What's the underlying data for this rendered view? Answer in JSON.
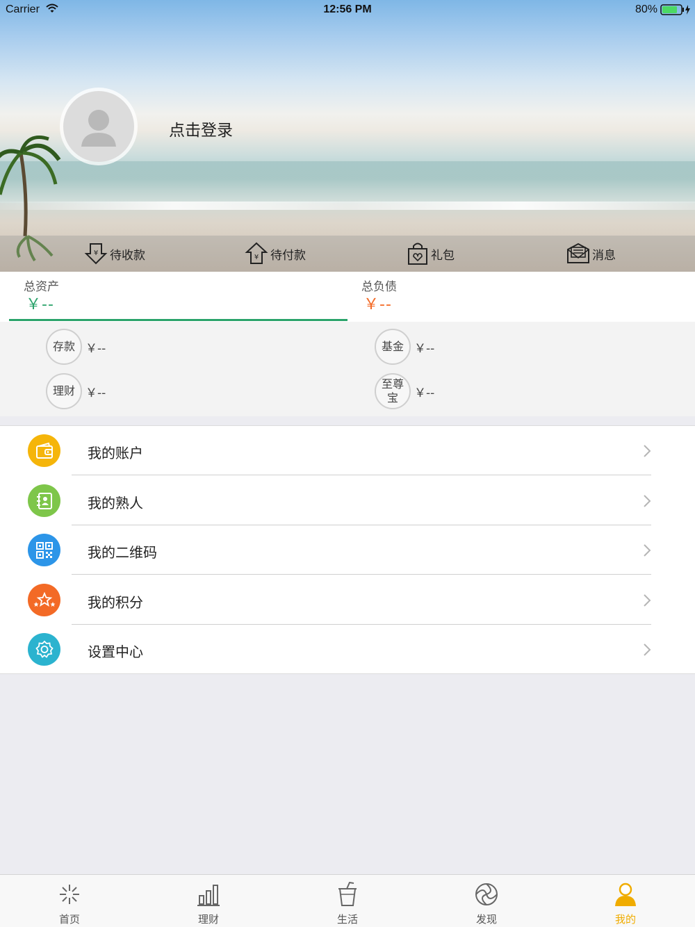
{
  "status_bar": {
    "carrier": "Carrier",
    "time": "12:56 PM",
    "battery": "80%"
  },
  "profile": {
    "login_label": "点击登录"
  },
  "quick_actions": [
    {
      "label": "待收款",
      "icon": "receive-money-icon"
    },
    {
      "label": "待付款",
      "icon": "pay-money-icon"
    },
    {
      "label": "礼包",
      "icon": "gift-bag-icon"
    },
    {
      "label": "消息",
      "icon": "message-icon"
    }
  ],
  "totals": {
    "assets": {
      "label": "总资产",
      "value": "￥--"
    },
    "liabilities": {
      "label": "总负债",
      "value": "￥--"
    }
  },
  "asset_items": [
    {
      "label": "存款",
      "value": "￥--"
    },
    {
      "label": "基金",
      "value": "￥--"
    },
    {
      "label": "理财",
      "value": "￥--"
    },
    {
      "label": "至尊宝",
      "value": "￥--"
    }
  ],
  "menu": [
    {
      "label": "我的账户",
      "icon": "wallet-icon",
      "color": "#f5b50a"
    },
    {
      "label": "我的熟人",
      "icon": "contacts-icon",
      "color": "#7ec64a"
    },
    {
      "label": "我的二维码",
      "icon": "qr-code-icon",
      "color": "#2c95e8"
    },
    {
      "label": "我的积分",
      "icon": "points-stars-icon",
      "color": "#f36a26"
    },
    {
      "label": "设置中心",
      "icon": "gear-icon",
      "color": "#2bb3cf"
    }
  ],
  "tabs": [
    {
      "label": "首页",
      "icon": "home-sparkle-icon"
    },
    {
      "label": "理财",
      "icon": "bar-chart-icon"
    },
    {
      "label": "生活",
      "icon": "drink-cup-icon"
    },
    {
      "label": "发现",
      "icon": "aperture-icon"
    },
    {
      "label": "我的",
      "icon": "person-icon",
      "active": true
    }
  ],
  "colors": {
    "asset_green": "#2ba36b",
    "debt_orange": "#f36a26",
    "tab_active": "#f0ac00"
  }
}
